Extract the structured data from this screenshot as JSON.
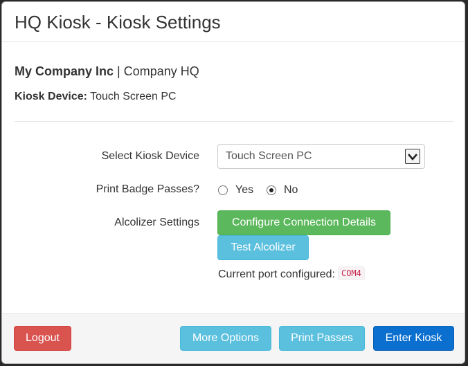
{
  "header": {
    "title": "HQ Kiosk - Kiosk Settings"
  },
  "info": {
    "company_name": "My Company Inc",
    "separator": "|",
    "location": "Company HQ",
    "device_label": "Kiosk Device:",
    "device_value": "Touch Screen PC"
  },
  "form": {
    "select_device_label": "Select Kiosk Device",
    "select_device_value": "Touch Screen PC",
    "print_badge_label": "Print Badge Passes?",
    "print_badge_options": [
      {
        "label": "Yes",
        "checked": false
      },
      {
        "label": "No",
        "checked": true
      }
    ],
    "alcolizer_label": "Alcolizer Settings",
    "configure_button": "Configure Connection Details",
    "test_button": "Test Alcolizer",
    "port_text": "Current port configured:",
    "port_value": "COM4"
  },
  "footer": {
    "logout": "Logout",
    "more_options": "More Options",
    "print_passes": "Print Passes",
    "enter_kiosk": "Enter Kiosk"
  },
  "colors": {
    "success": "#5cb85c",
    "info": "#5bc0de",
    "danger": "#d9534f",
    "primary": "#0a6fcf",
    "code_text": "#c7254e"
  },
  "icons": {
    "select_arrow": "chevron-down-icon"
  }
}
